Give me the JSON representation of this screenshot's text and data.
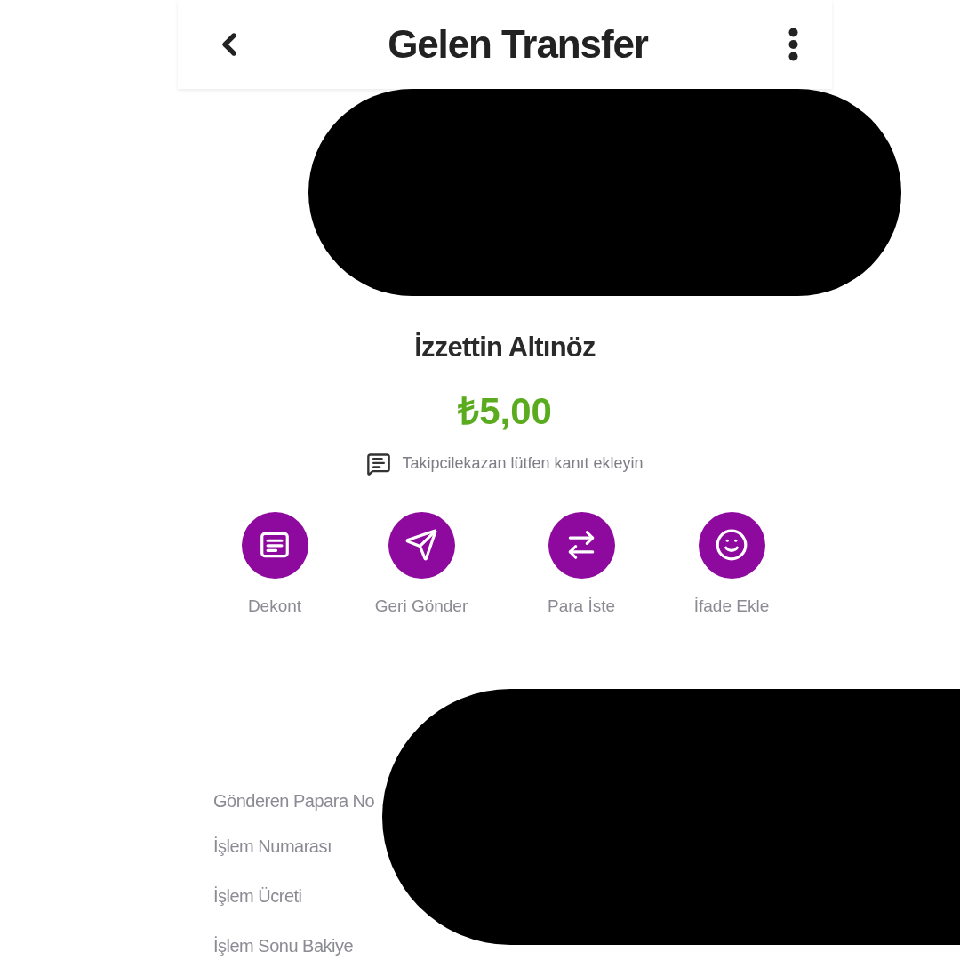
{
  "header": {
    "title": "Gelen Transfer"
  },
  "sender": {
    "name": "İzzettin Altınöz",
    "amount": "₺5,00",
    "note": "Takipcilekazan lütfen kanıt ekleyin"
  },
  "actions": [
    {
      "kind": "receipt",
      "label": "Dekont"
    },
    {
      "kind": "send",
      "label": "Geri Gönder"
    },
    {
      "kind": "swap",
      "label": "Para İste"
    },
    {
      "kind": "emoji",
      "label": "İfade Ekle"
    }
  ],
  "details": [
    {
      "label": "Gönderen Papara No"
    },
    {
      "label": "İşlem Numarası"
    },
    {
      "label": "İşlem Ücreti"
    },
    {
      "label": "İşlem Sonu Bakiye"
    }
  ]
}
